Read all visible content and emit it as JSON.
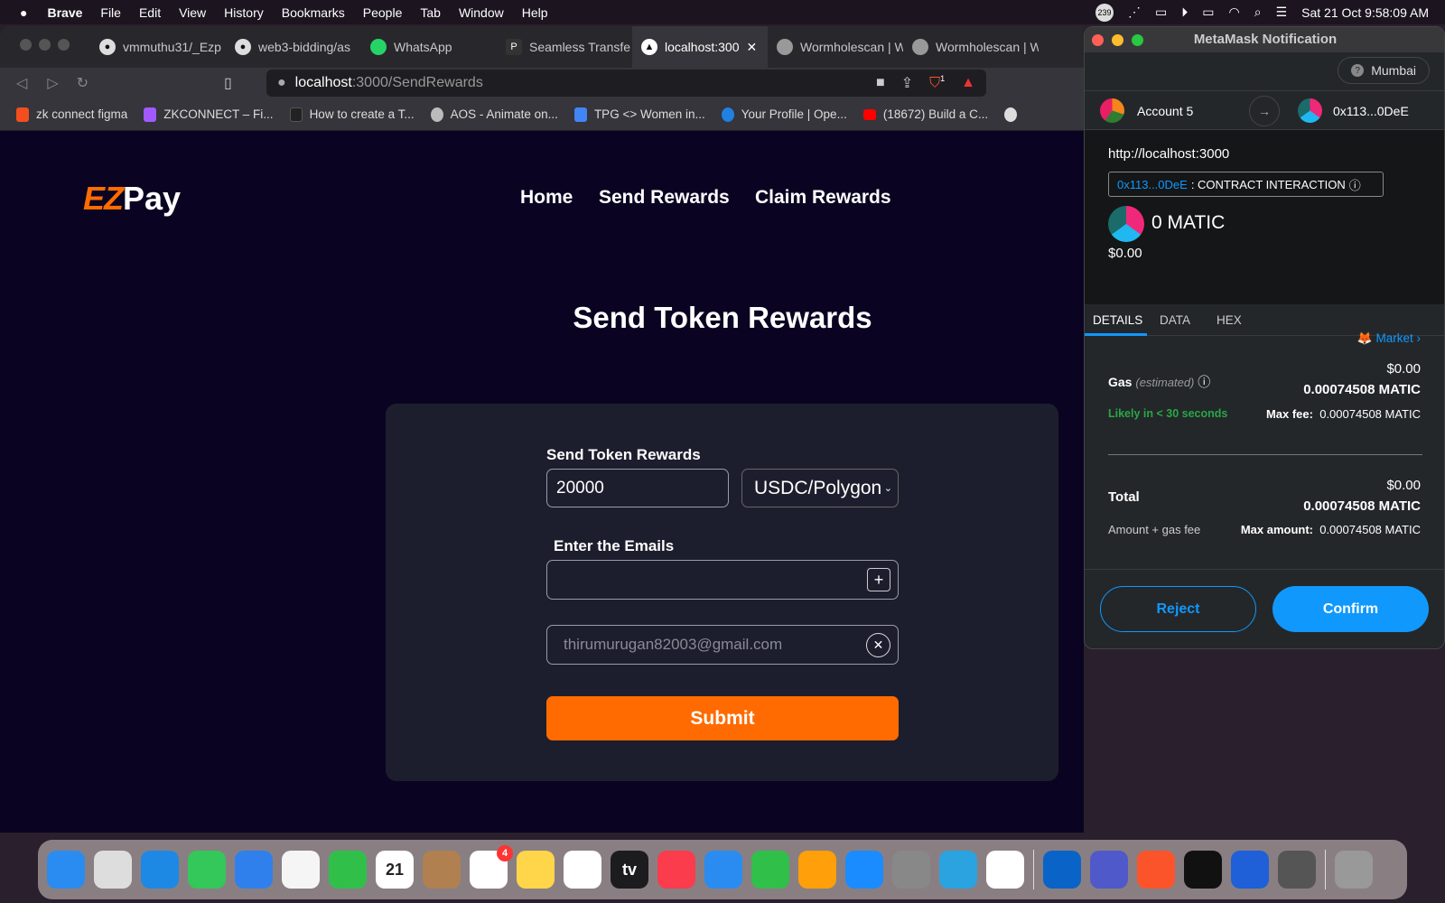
{
  "menubar": {
    "apple": "",
    "items": [
      "Brave",
      "File",
      "Edit",
      "View",
      "History",
      "Bookmarks",
      "People",
      "Tab",
      "Window",
      "Help"
    ],
    "badge": "239",
    "datetime": "Sat 21 Oct  9:58:09 AM"
  },
  "tabs": [
    {
      "label": "vmmuthu31/_Ezp",
      "icon": "github-icon"
    },
    {
      "label": "web3-bidding/as",
      "icon": "github-icon"
    },
    {
      "label": "WhatsApp",
      "icon": "whatsapp-icon"
    },
    {
      "label": "Seamless Transfe",
      "icon": "app-icon"
    },
    {
      "label": "localhost:300",
      "icon": "triangle-icon",
      "active": true
    },
    {
      "label": "Wormholescan | W",
      "icon": "globe-icon"
    },
    {
      "label": "Wormholescan | W",
      "icon": "globe-icon"
    }
  ],
  "url": {
    "host": "localhost",
    "path": ":3000/SendRewards",
    "brave_badge": "1"
  },
  "bookmarks": [
    {
      "label": "zk connect figma",
      "color": "#f24e1e"
    },
    {
      "label": "ZKCONNECT – Fi...",
      "color": "#a259ff"
    },
    {
      "label": "How to create a T...",
      "color": "#222"
    },
    {
      "label": "AOS - Animate on...",
      "color": "#bbb"
    },
    {
      "label": "TPG <> Women in...",
      "color": "#4285f4"
    },
    {
      "label": "Your Profile | Ope...",
      "color": "#2081e2"
    },
    {
      "label": "(18672) Build a C...",
      "color": "#ff0000"
    }
  ],
  "site": {
    "logo_ez": "EZ",
    "logo_pay": "Pay",
    "nav": [
      "Home",
      "Send Rewards",
      "Claim Rewards"
    ],
    "heading": "Send Token Rewards",
    "form": {
      "amount_label": "Send Token Rewards",
      "amount": "20000",
      "token": "USDC/Polygon",
      "emails_label": "Enter the Emails",
      "email_input": "",
      "email_added": "thirumurugan82003@gmail.com",
      "submit": "Submit"
    },
    "accent": "#ff6b00"
  },
  "metamask": {
    "title": "MetaMask Notification",
    "network": "Mumbai",
    "from": "Account 5",
    "to": "0x113...0DeE",
    "origin": "http://localhost:3000",
    "contract_addr": "0x113...0DeE",
    "contract_label": ": CONTRACT INTERACTION",
    "amount": "0 MATIC",
    "amount_usd": "$0.00",
    "tabs": [
      "DETAILS",
      "DATA",
      "HEX"
    ],
    "market": "Market",
    "gas_label": "Gas",
    "gas_est": "(estimated)",
    "gas_usd": "$0.00",
    "gas_matic": "0.00074508 MATIC",
    "likely": "Likely in < 30 seconds",
    "max_fee_label": "Max fee:",
    "max_fee": "0.00074508 MATIC",
    "total_label": "Total",
    "total_usd": "$0.00",
    "total_matic": "0.00074508 MATIC",
    "amount_gas": "Amount + gas fee",
    "max_amount_label": "Max amount:",
    "max_amount": "0.00074508 MATIC",
    "reject": "Reject",
    "confirm": "Confirm",
    "accent": "#1098fc"
  },
  "dock": [
    {
      "name": "Finder",
      "color": "#2a8cf0"
    },
    {
      "name": "Launchpad",
      "color": "#ddd"
    },
    {
      "name": "Safari",
      "color": "#1e88e5"
    },
    {
      "name": "Messages",
      "color": "#34c759"
    },
    {
      "name": "Mail",
      "color": "#2f80ed"
    },
    {
      "name": "Photos",
      "color": "#f5f5f5"
    },
    {
      "name": "FaceTime",
      "color": "#30c04a"
    },
    {
      "name": "Calendar",
      "color": "#fff",
      "text": "21"
    },
    {
      "name": "Contacts",
      "color": "#b08050"
    },
    {
      "name": "Reminders",
      "color": "#fff",
      "badge": "4"
    },
    {
      "name": "Notes",
      "color": "#ffd54a"
    },
    {
      "name": "Freeform",
      "color": "#fff"
    },
    {
      "name": "TV",
      "color": "#1c1c1e",
      "text": "tv"
    },
    {
      "name": "Music",
      "color": "#fa3c4c"
    },
    {
      "name": "Keynote",
      "color": "#2a8cf0"
    },
    {
      "name": "Numbers",
      "color": "#30c04a"
    },
    {
      "name": "Pages",
      "color": "#ff9f0a"
    },
    {
      "name": "App Store",
      "color": "#1a8cff"
    },
    {
      "name": "System Settings",
      "color": "#888"
    },
    {
      "name": "Telegram",
      "color": "#2aa3e0"
    },
    {
      "name": "VS Code",
      "color": "#fff"
    },
    {
      "name": "Outlook",
      "color": "#0a64c8"
    },
    {
      "name": "Teams",
      "color": "#5059c9"
    },
    {
      "name": "Brave",
      "color": "#fb542b"
    },
    {
      "name": "Terminal",
      "color": "#111"
    },
    {
      "name": "Maps Pin",
      "color": "#1f5fd8"
    },
    {
      "name": "Calculator",
      "color": "#555"
    },
    {
      "name": "Trash",
      "color": "#999"
    }
  ]
}
